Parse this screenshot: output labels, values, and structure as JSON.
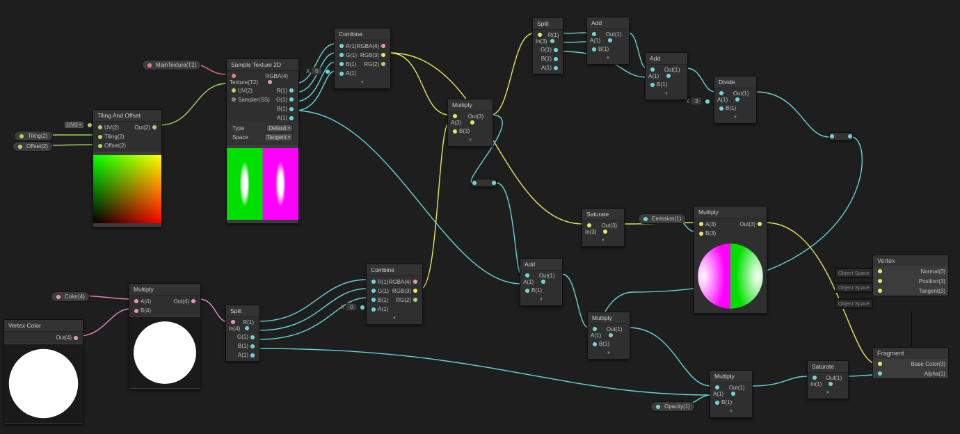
{
  "props": {
    "mainTexture": "MainTexture(T2)",
    "tiling": "Tiling(2)",
    "offset": "Offset(2)",
    "color": "Color(4)",
    "emission": "Emission(1)",
    "opacity": "Opacity(1)"
  },
  "inlineDefaults": {
    "uvDropdown": "UV0",
    "combine1X": {
      "label": "X",
      "value": "0"
    },
    "combine2X": {
      "label": "X",
      "value": "0"
    },
    "divideX": {
      "label": "X",
      "value": "3"
    }
  },
  "nodes": {
    "tilingOffset": {
      "title": "Tiling And Offset",
      "in": [
        "UV(2)",
        "Tiling(2)",
        "Offset(2)"
      ],
      "out": [
        "Out(2)"
      ]
    },
    "sampleTex": {
      "title": "Sample Texture 2D",
      "in": [
        "Texture(T2)",
        "UV(2)",
        "Sampler(SS)"
      ],
      "out": [
        "RGBA(4)",
        "R(1)",
        "G(1)",
        "B(1)",
        "A(1)"
      ],
      "params": {
        "typeLabel": "Type",
        "type": "Default",
        "spaceLabel": "Space",
        "space": "Tangent"
      }
    },
    "combine1": {
      "title": "Combine",
      "in": [
        "R(1)",
        "G(1)",
        "B(1)",
        "A(1)"
      ],
      "out": [
        "RGBA(4)",
        "RGB(3)",
        "RG(2)"
      ]
    },
    "vertexColor": {
      "title": "Vertex Color",
      "out": [
        "Out(4)"
      ]
    },
    "multiplyA": {
      "title": "Multiply",
      "in": [
        "A(4)",
        "B(4)"
      ],
      "out": [
        "Out(4)"
      ]
    },
    "split2": {
      "title": "Split",
      "in": [
        "In(4)"
      ],
      "out": [
        "R(1)",
        "G(1)",
        "B(1)",
        "A(1)"
      ]
    },
    "combine2": {
      "title": "Combine",
      "in": [
        "R(1)",
        "G(1)",
        "B(1)",
        "A(1)"
      ],
      "out": [
        "RGBA(4)",
        "RGB(3)",
        "RG(2)"
      ]
    },
    "multiplyB": {
      "title": "Multiply",
      "in": [
        "A(3)",
        "B(3)"
      ],
      "out": [
        "Out(3)"
      ]
    },
    "split1": {
      "title": "Split",
      "in": [
        "In(3)"
      ],
      "out": [
        "R(1)",
        "G(1)",
        "B(1)",
        "A(1)"
      ]
    },
    "add1": {
      "title": "Add",
      "in": [
        "A(1)",
        "B(1)"
      ],
      "out": [
        "Out(1)"
      ]
    },
    "add2": {
      "title": "Add",
      "in": [
        "A(1)",
        "B(1)"
      ],
      "out": [
        "Out(1)"
      ]
    },
    "divide": {
      "title": "Divide",
      "in": [
        "A(1)",
        "B(1)"
      ],
      "out": [
        "Out(1)"
      ]
    },
    "saturate1": {
      "title": "Saturate",
      "in": [
        "In(3)"
      ],
      "out": [
        "Out(3)"
      ]
    },
    "multiplyC": {
      "title": "Multiply",
      "in": [
        "A(3)",
        "B(3)"
      ],
      "out": [
        "Out(3)"
      ]
    },
    "add3": {
      "title": "Add",
      "in": [
        "A(1)",
        "B(1)"
      ],
      "out": [
        "Out(1)"
      ]
    },
    "multiplyD": {
      "title": "Multiply",
      "in": [
        "A(1)",
        "B(1)"
      ],
      "out": [
        "Out(1)"
      ]
    },
    "multiplyE": {
      "title": "Multiply",
      "in": [
        "A(1)",
        "B(1)"
      ],
      "out": [
        "Out(1)"
      ]
    },
    "saturate2": {
      "title": "Saturate",
      "in": [
        "In(1)"
      ],
      "out": [
        "Out(1)"
      ]
    }
  },
  "master": {
    "vertex": {
      "title": "Vertex",
      "objectSpace": "Object Space",
      "rows": [
        "Normal(3)",
        "Position(3)",
        "Tangent(3)"
      ]
    },
    "fragment": {
      "title": "Fragment",
      "rows": [
        "Base Color(3)",
        "Alpha(1)"
      ]
    }
  }
}
